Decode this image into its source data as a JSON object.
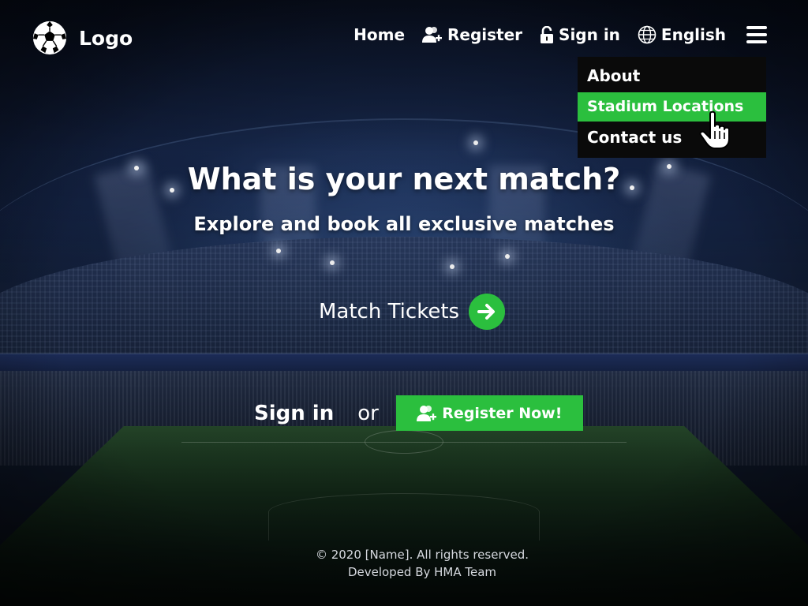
{
  "brand": {
    "logo_text": "Logo",
    "accent_color": "#2bbf3e"
  },
  "nav": {
    "home": "Home",
    "register": "Register",
    "signin": "Sign in",
    "language": "English",
    "icons": [
      "user-plus-icon",
      "lock-icon",
      "globe-icon",
      "hamburger-menu-icon"
    ]
  },
  "dropdown": {
    "items": [
      {
        "label": "About",
        "active": false
      },
      {
        "label": "Stadium Locations",
        "active": true
      },
      {
        "label": "Contact us",
        "active": false
      }
    ]
  },
  "hero": {
    "title": "What is your next match?",
    "subtitle": "Explore and book all exclusive matches",
    "cta_label": "Match Tickets"
  },
  "auth": {
    "signin": "Sign in",
    "or": "or",
    "register_button": "Register Now!"
  },
  "footer": {
    "copyright": "© 2020 [Name]. All rights reserved.",
    "developer": "Developed By HMA Team"
  }
}
